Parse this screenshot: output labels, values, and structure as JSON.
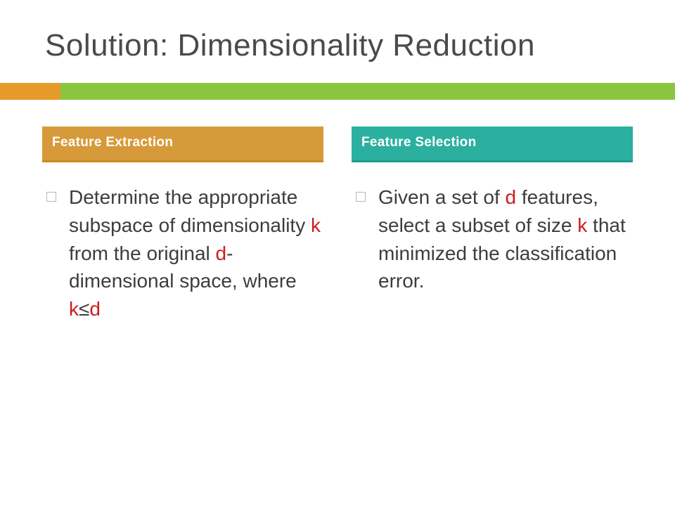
{
  "title": "Solution: Dimensionality Reduction",
  "colors": {
    "accent_orange": "#e69a2a",
    "accent_green": "#8bc53f",
    "header_left": "#d79a3a",
    "header_right": "#2bb0a0",
    "highlight": "#d11a1a"
  },
  "left": {
    "header": "Feature Extraction",
    "text_parts": {
      "p1": "Determine the appropriate subspace of dimensionality ",
      "k1": "k",
      "p2": " from the original ",
      "d1": "d",
      "p3": "-dimensional space, where ",
      "k2": "k",
      "le": "≤",
      "d2": "d"
    }
  },
  "right": {
    "header": "Feature Selection",
    "text_parts": {
      "p1": "Given a set of ",
      "d1": "d",
      "p2": " features, select a subset of size ",
      "k1": "k",
      "p3": " that minimized the classification error."
    }
  }
}
